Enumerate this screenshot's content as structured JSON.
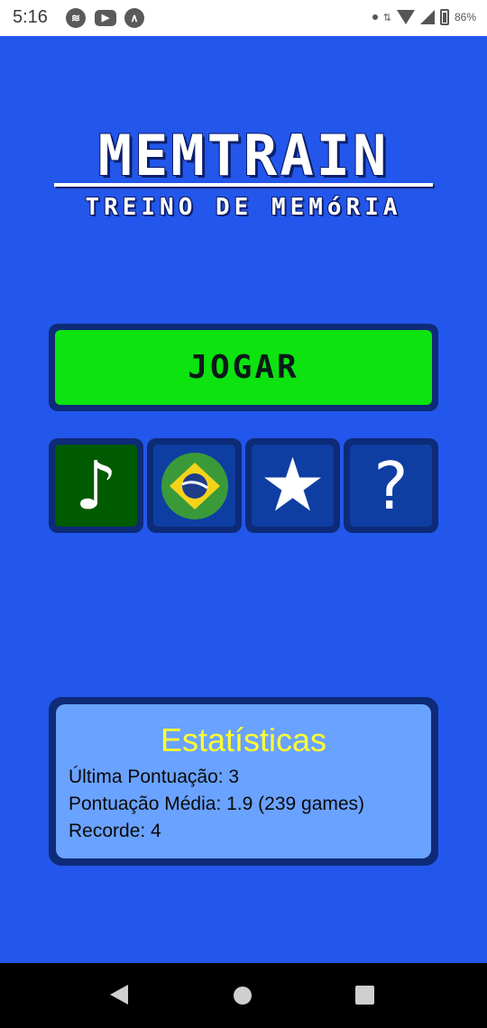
{
  "status_bar": {
    "time": "5:16",
    "battery": "86%",
    "apps": [
      "spotify-icon",
      "youtube-icon",
      "arc-icon"
    ]
  },
  "logo": {
    "title": "MEMTRAIN",
    "subtitle": "TREINO DE MEMóRIA"
  },
  "play_button": {
    "label": "JOGAR",
    "color": "#0ce30f"
  },
  "tiles": [
    {
      "name": "music-toggle",
      "glyph": "♪"
    },
    {
      "name": "language-toggle",
      "icon": "brazil-flag-icon"
    },
    {
      "name": "rate-app",
      "glyph": "★"
    },
    {
      "name": "help",
      "glyph": "?"
    }
  ],
  "stats": {
    "title": "Estatísticas",
    "last_score": "Última Pontuação: 3",
    "average_score": "Pontuação Média: 1.9 (239 games)",
    "record": "Recorde: 4"
  },
  "colors": {
    "background": "#2356ea",
    "frame": "#0e2b78",
    "stats_title": "#ffff30",
    "stats_bg": "#6aa2ff"
  }
}
